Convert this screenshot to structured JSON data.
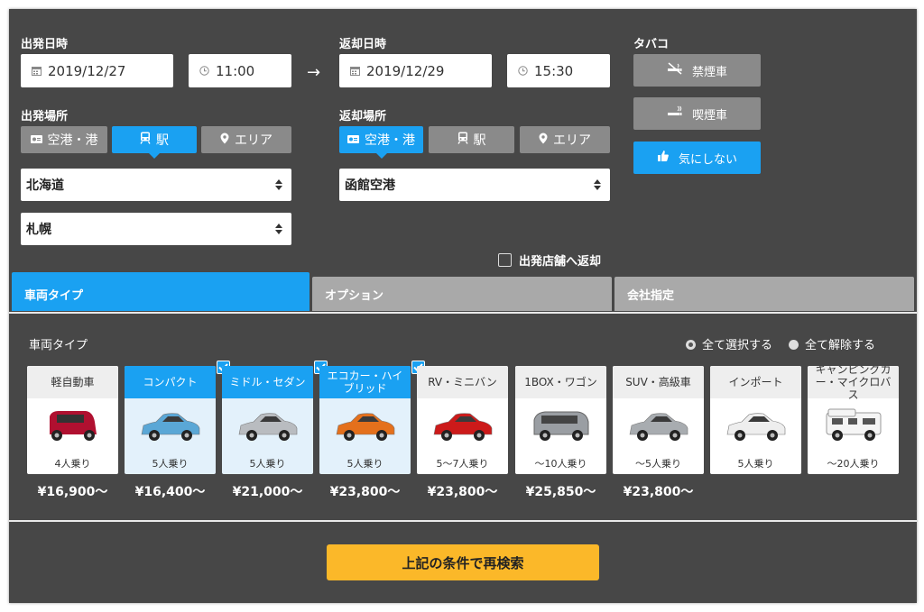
{
  "departure": {
    "datetime_label": "出発日時",
    "date": "2019/12/27",
    "time": "11:00",
    "place_label": "出発場所",
    "place_tabs": [
      {
        "label": "空港・港",
        "active": false
      },
      {
        "label": "駅",
        "active": true
      },
      {
        "label": "エリア",
        "active": false
      }
    ],
    "region": "北海道",
    "station": "札幌"
  },
  "arrow": "→",
  "return": {
    "datetime_label": "返却日時",
    "date": "2019/12/29",
    "time": "15:30",
    "place_label": "返却場所",
    "place_tabs": [
      {
        "label": "空港・港",
        "active": true
      },
      {
        "label": "駅",
        "active": false
      },
      {
        "label": "エリア",
        "active": false
      }
    ],
    "airport": "函館空港",
    "same_store_label": "出発店舗へ返却",
    "same_store_checked": false
  },
  "tobacco": {
    "label": "タバコ",
    "options": [
      {
        "label": "禁煙車",
        "active": false
      },
      {
        "label": "喫煙車",
        "active": false
      },
      {
        "label": "気にしない",
        "active": true
      }
    ]
  },
  "tabs": [
    {
      "label": "車両タイプ",
      "active": true
    },
    {
      "label": "オプション",
      "active": false
    },
    {
      "label": "会社指定",
      "active": false
    }
  ],
  "vehicle": {
    "section_title": "車両タイプ",
    "select_all": "全て選択する",
    "deselect_all": "全て解除する",
    "types": [
      {
        "name": "軽自動車",
        "capacity": "4人乗り",
        "price": "¥16,900〜",
        "selected": false,
        "color": "#b01030"
      },
      {
        "name": "コンパクト",
        "capacity": "5人乗り",
        "price": "¥16,400〜",
        "selected": true,
        "color": "#5aa7d6"
      },
      {
        "name": "ミドル・セダン",
        "capacity": "5人乗り",
        "price": "¥21,000〜",
        "selected": true,
        "color": "#b9bcc0"
      },
      {
        "name": "エコカー・ハイブリッド",
        "capacity": "5人乗り",
        "price": "¥23,800〜",
        "selected": true,
        "color": "#e4701c"
      },
      {
        "name": "RV・ミニバン",
        "capacity": "5〜7人乗り",
        "price": "¥23,800〜",
        "selected": false,
        "color": "#cc1a1a"
      },
      {
        "name": "1BOX・ワゴン",
        "capacity": "〜10人乗り",
        "price": "¥25,850〜",
        "selected": false,
        "color": "#9a9ea3"
      },
      {
        "name": "SUV・高級車",
        "capacity": "〜5人乗り",
        "price": "¥23,800〜",
        "selected": false,
        "color": "#a8acb0"
      },
      {
        "name": "インポート",
        "capacity": "5人乗り",
        "price": "",
        "selected": false,
        "color": "#eeeeee"
      },
      {
        "name": "キャンピングカー・マイクロバス",
        "capacity": "〜20人乗り",
        "price": "",
        "selected": false,
        "color": "#f2f2f2"
      }
    ]
  },
  "search_button": "上記の条件で再検索",
  "colors": {
    "panel": "#474747",
    "accent": "#1aa1f2",
    "button": "#fbb829"
  }
}
